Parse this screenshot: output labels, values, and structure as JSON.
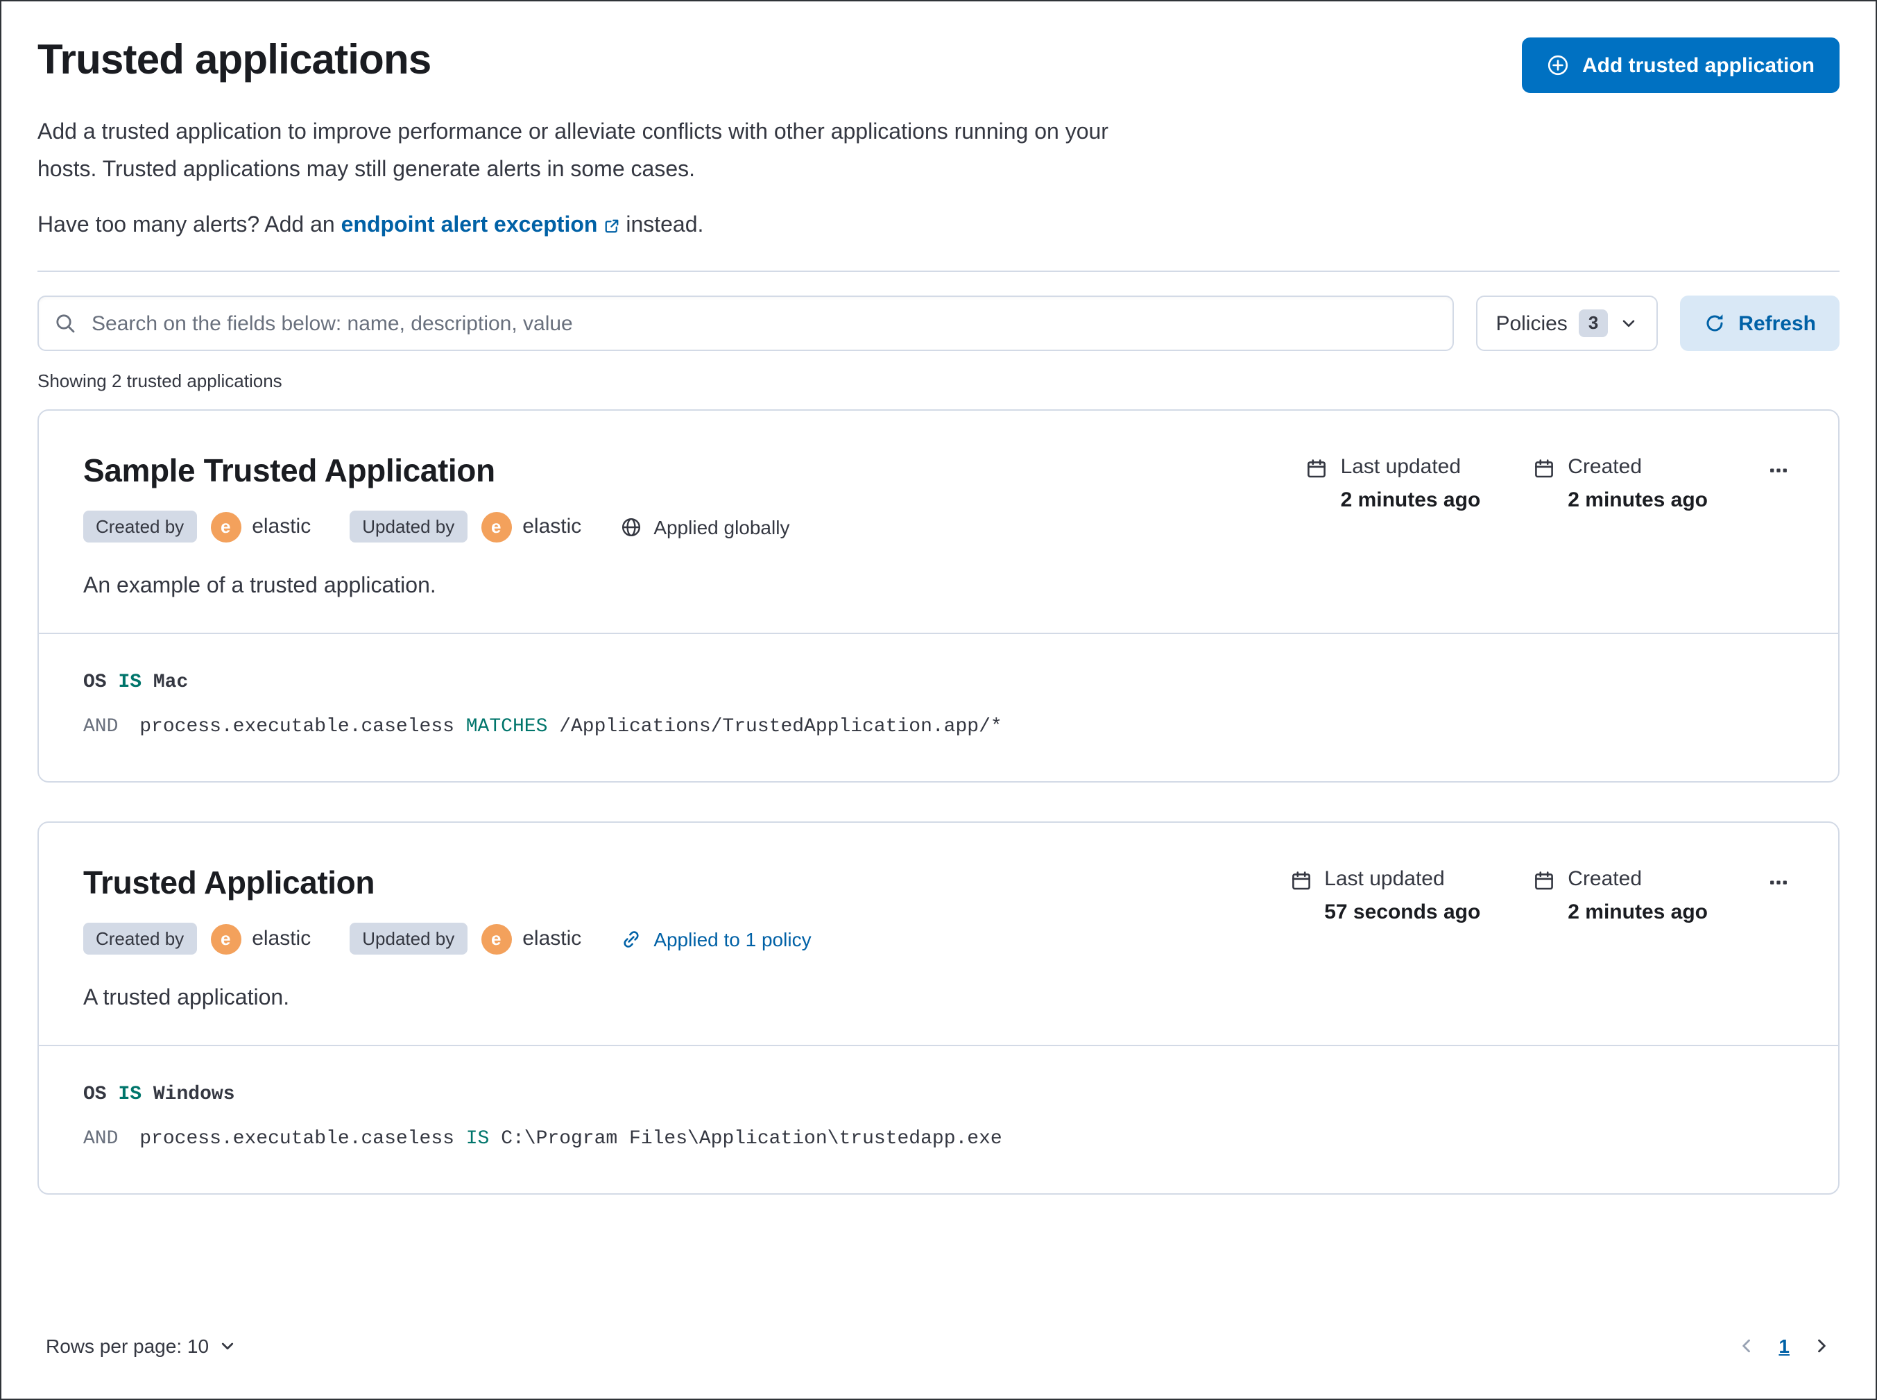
{
  "page": {
    "title": "Trusted applications",
    "intro": "Add a trusted application to improve performance or alleviate conflicts with other applications running on your hosts. Trusted applications may still generate alerts in some cases.",
    "alerts_prompt_prefix": "Have too many alerts? Add an ",
    "alerts_link_label": "endpoint alert exception",
    "alerts_prompt_suffix": " instead.",
    "add_button_label": "Add trusted application",
    "results_count_text": "Showing 2 trusted applications"
  },
  "toolbar": {
    "search_placeholder": "Search on the fields below: name, description, value",
    "policies_button_label": "Policies",
    "policies_count_badge": "3",
    "refresh_button_label": "Refresh"
  },
  "cards": [
    {
      "title": "Sample Trusted Application",
      "created_by_badge": "Created by",
      "created_by_avatar": "e",
      "created_by_user": "elastic",
      "updated_by_badge": "Updated by",
      "updated_by_avatar": "e",
      "updated_by_user": "elastic",
      "scope_label": "Applied globally",
      "last_updated_label": "Last updated",
      "last_updated_value": "2 minutes ago",
      "created_label": "Created",
      "created_value": "2 minutes ago",
      "description": "An example of a trusted application.",
      "condition_1": {
        "field": "OS",
        "operator": "IS",
        "value": "Mac"
      },
      "condition_2": {
        "conjunction": "AND",
        "field": "process.executable.caseless",
        "operator": "MATCHES",
        "value": "/Applications/TrustedApplication.app/*"
      }
    },
    {
      "title": "Trusted Application",
      "created_by_badge": "Created by",
      "created_by_avatar": "e",
      "created_by_user": "elastic",
      "updated_by_badge": "Updated by",
      "updated_by_avatar": "e",
      "updated_by_user": "elastic",
      "scope_label": "Applied to 1 policy",
      "last_updated_label": "Last updated",
      "last_updated_value": "57 seconds ago",
      "created_label": "Created",
      "created_value": "2 minutes ago",
      "description": "A trusted application.",
      "condition_1": {
        "field": "OS",
        "operator": "IS",
        "value": "Windows"
      },
      "condition_2": {
        "conjunction": "AND",
        "field": "process.executable.caseless",
        "operator": "IS",
        "value": "C:\\Program Files\\Application\\trustedapp.exe"
      }
    }
  ],
  "footer": {
    "rows_per_page_label": "Rows per page: 10",
    "page_number": "1"
  },
  "colors": {
    "primary_button": "#0071c2",
    "link": "#0061a6",
    "operator_teal": "#00756b",
    "avatar_orange": "#f3a15c",
    "border": "#d3dae6"
  }
}
